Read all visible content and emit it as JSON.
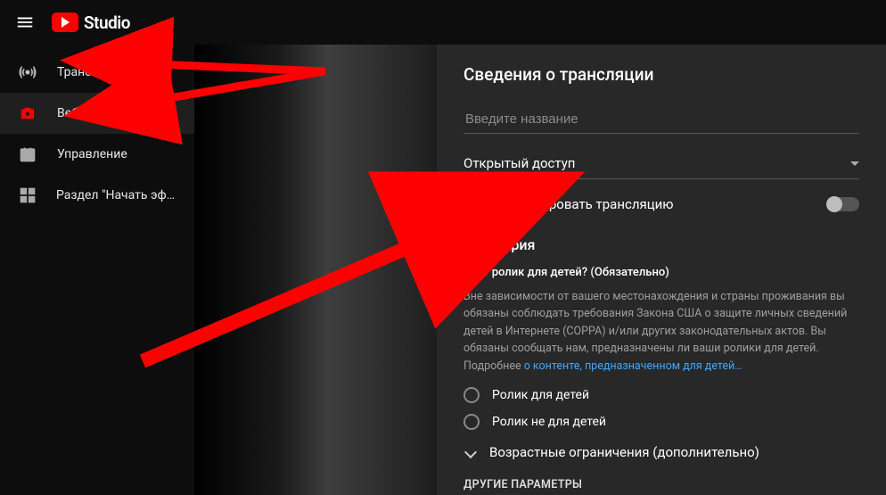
{
  "header": {
    "logo_text": "Studio"
  },
  "sidebar": {
    "items": [
      {
        "id": "streams",
        "label": "Трансляции"
      },
      {
        "id": "webcam",
        "label": "Веб-камера"
      },
      {
        "id": "manage",
        "label": "Управление"
      },
      {
        "id": "section",
        "label": "Раздел \"Начать эфи…"
      }
    ],
    "active_index": 1
  },
  "panel": {
    "title": "Сведения о трансляции",
    "title_input": {
      "placeholder": "Введите название",
      "value": ""
    },
    "visibility": {
      "selected": "Открытый доступ"
    },
    "schedule": {
      "label": "Запланировать трансляцию",
      "enabled": false
    },
    "audience": {
      "heading": "Аудитория",
      "question": "Этот ролик для детей? (Обязательно)",
      "description": "Вне зависимости от вашего местонахождения и страны проживания вы обязаны соблюдать требования Закона США о защите личных сведений детей в Интернете (COPPA) и/или других законодательных актов. Вы обязаны сообщать нам, предназначены ли ваши ролики для детей. Подробнее ",
      "link_text": "о контенте, предназначенном для детей…",
      "option_yes": "Ролик для детей",
      "option_no": "Ролик не для детей",
      "age_restriction": "Возрастные ограничения (дополнительно)"
    },
    "other_params": "ДРУГИЕ ПАРАМЕТРЫ"
  },
  "colors": {
    "accent": "#ff0000",
    "link": "#3ea6ff",
    "panel_bg": "#282828"
  }
}
